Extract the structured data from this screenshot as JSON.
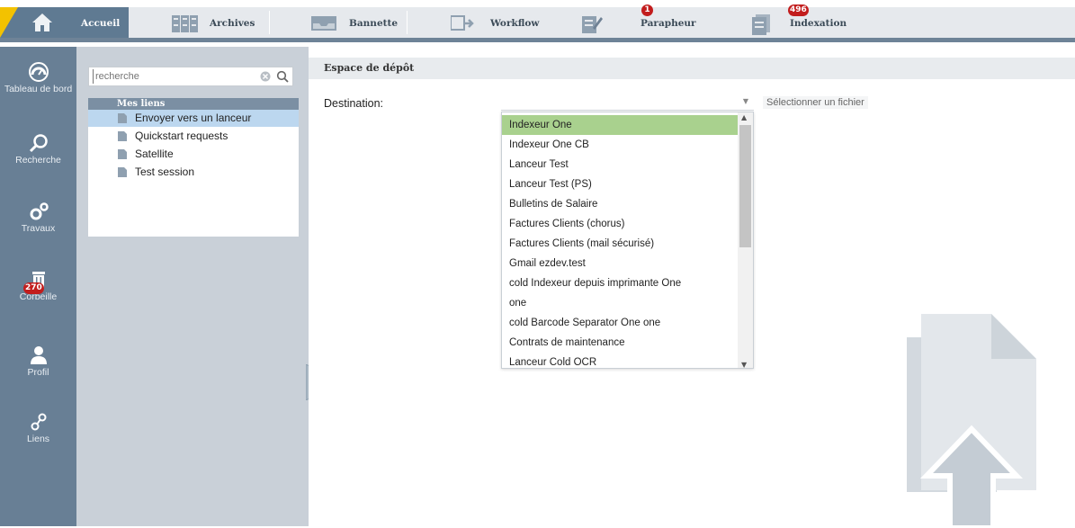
{
  "topbar": {
    "tabs": [
      {
        "label": "Accueil",
        "icon": "home-icon",
        "active": true
      },
      {
        "label": "Archives",
        "icon": "archives-icon",
        "flag_color": "#6ec12a"
      },
      {
        "label": "Bannette",
        "icon": "tray-icon",
        "flag_color": "#2f8fd8"
      },
      {
        "label": "Workflow",
        "icon": "workflow-icon",
        "flag_color": "#d4202a"
      },
      {
        "label": "Parapheur",
        "icon": "signature-book-icon",
        "flag_color": "#d4202a",
        "badge": "1"
      },
      {
        "label": "Indexation",
        "icon": "indexation-icon",
        "flag_color": "#e0156b",
        "badge": "496"
      }
    ],
    "colors": {
      "active_bg": "#5f7a92",
      "accent_yellow": "#f3c200",
      "badge_red": "#c21d1d"
    }
  },
  "leftnav": {
    "items": [
      {
        "label": "Tableau de bord",
        "icon": "dashboard-gauge-icon"
      },
      {
        "label": "Recherche",
        "icon": "search-icon"
      },
      {
        "label": "Travaux",
        "icon": "gears-icon"
      },
      {
        "label": "Corbeille",
        "icon": "trash-icon",
        "badge": "270"
      },
      {
        "label": "Profil",
        "icon": "user-icon"
      },
      {
        "label": "Liens",
        "icon": "link-icon"
      }
    ]
  },
  "links_panel": {
    "search_placeholder": "recherche",
    "header": "Mes liens",
    "links": [
      {
        "label": "Envoyer vers un lanceur",
        "selected": true
      },
      {
        "label": "Quickstart requests"
      },
      {
        "label": "Satellite"
      },
      {
        "label": "Test session"
      }
    ]
  },
  "main": {
    "section_title": "Espace de dépôt",
    "destination_label": "Destination:",
    "destination_value": "",
    "choose_file_label": "Sélectionner un fichier",
    "dropdown_options": [
      "Indexeur One",
      "Indexeur One CB",
      "Lanceur Test",
      "Lanceur Test (PS)",
      "Bulletins de Salaire",
      "Factures Clients (chorus)",
      "Factures Clients (mail sécurisé)",
      "Gmail ezdev.test",
      "cold Indexeur depuis imprimante One",
      "one",
      "cold Barcode Separator One one",
      "Contrats de maintenance",
      "Lanceur Cold OCR"
    ],
    "highlighted_option_index": 0,
    "highlight_color": "#a9d18e"
  }
}
